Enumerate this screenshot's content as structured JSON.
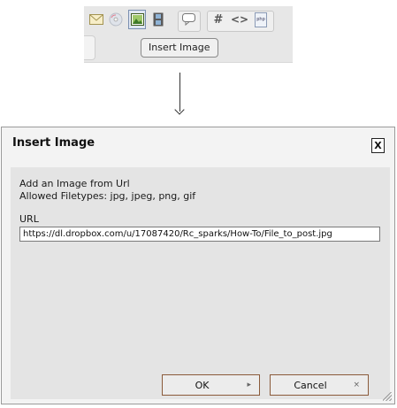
{
  "toolbar": {
    "icons": [
      "email-icon",
      "disc-icon",
      "image-icon",
      "film-icon",
      "speech-bubble-icon",
      "hash-icon",
      "code-icon",
      "php-icon"
    ],
    "hash_glyph": "#",
    "code_glyph": "<>",
    "php_glyph": "php",
    "tooltip": "Insert Image"
  },
  "dialog": {
    "title": "Insert Image",
    "close_label": "X",
    "intro_line1": "Add an Image from Url",
    "intro_line2": "Allowed Filetypes: jpg, jpeg, png, gif",
    "url_label": "URL",
    "url_value": "https://dl.dropbox.com/u/17087420/Rc_sparks/How-To/File_to_post.jpg",
    "ok_label": "OK",
    "ok_icon": "▸",
    "cancel_label": "Cancel",
    "cancel_icon": "×"
  }
}
